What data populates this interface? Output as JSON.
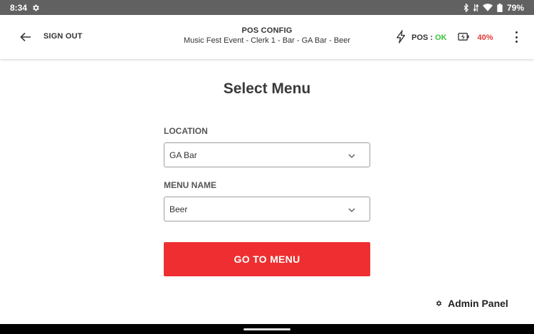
{
  "statusbar": {
    "time": "8:34",
    "battery": "79%"
  },
  "appbar": {
    "signout_label": "SIGN OUT",
    "title": "POS CONFIG",
    "subtitle": "Music Fest Event - Clerk 1 - Bar - GA Bar - Beer",
    "pos_label": "POS :",
    "pos_status": "OK",
    "battery_pct": "40%"
  },
  "main": {
    "heading": "Select Menu",
    "location": {
      "label": "LOCATION",
      "value": "GA Bar"
    },
    "menu_name": {
      "label": "MENU NAME",
      "value": "Beer"
    },
    "go_button": "GO TO MENU"
  },
  "footer": {
    "admin_label": "Admin Panel"
  },
  "colors": {
    "accent": "#ee2e31",
    "ok": "#3cc33c",
    "battery_low": "#e53935",
    "statusbar": "#616161"
  },
  "icons": [
    "settings-icon",
    "bluetooth-icon",
    "wifi-icon",
    "battery-icon",
    "back-arrow-icon",
    "lightning-icon",
    "battery-charging-icon",
    "more-vert-icon",
    "chevron-down-icon",
    "gear-icon"
  ]
}
